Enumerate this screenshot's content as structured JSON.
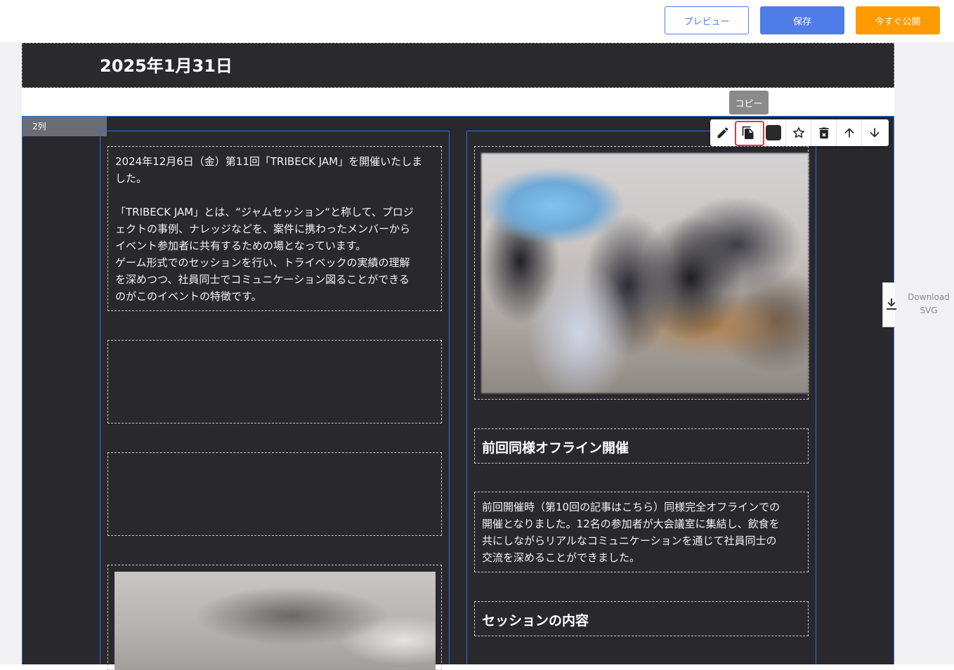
{
  "header": {
    "preview_label": "プレビュー",
    "save_label": "保存",
    "publish_label": "今すぐ公開"
  },
  "colors": {
    "accent_blue": "#4f7ce6",
    "publish_orange": "#ff9a00",
    "dark_background": "#29282d",
    "highlight_red": "#e53935"
  },
  "article": {
    "date": "2025年1月31日",
    "section_label": "2列",
    "left_column": {
      "paragraph_lines": [
        "2024年12月6日（金）第11回「TRIBECK JAM」を開催いたしま",
        "した。",
        "",
        "「TRIBECK JAM」とは、“ジャムセッション“と称して、プロジ",
        "ェクトの事例、ナレッジなどを、案件に携わったメンバーから",
        "イベント参加者に共有するための場となっています。",
        "ゲーム形式でのセッションを行い、トライベックの実績の理解",
        "を深めつつ、社員同士でコミュニケーション図ることができる",
        "のがこのイベントの特徴です。"
      ]
    },
    "right_column": {
      "heading1": "前回同様オフライン開催",
      "paragraph_lines": [
        "前回開催時（第10回の記事はこちら）同様完全オフラインでの",
        "開催となりました。12名の参加者が大会議室に集結し、飲食を",
        "共にしながらリアルなコミュニケーションを通じて社員同士の",
        "交流を深めることができました。"
      ],
      "heading2": "セッションの内容"
    }
  },
  "block_toolbar": {
    "tooltip": "コピー",
    "icons": [
      "pencil-icon",
      "copy-icon",
      "color-swatch",
      "star-icon",
      "delete-icon",
      "arrow-up-icon",
      "arrow-down-icon"
    ]
  },
  "download_panel": {
    "line1": "Download",
    "line2": "SVG"
  }
}
